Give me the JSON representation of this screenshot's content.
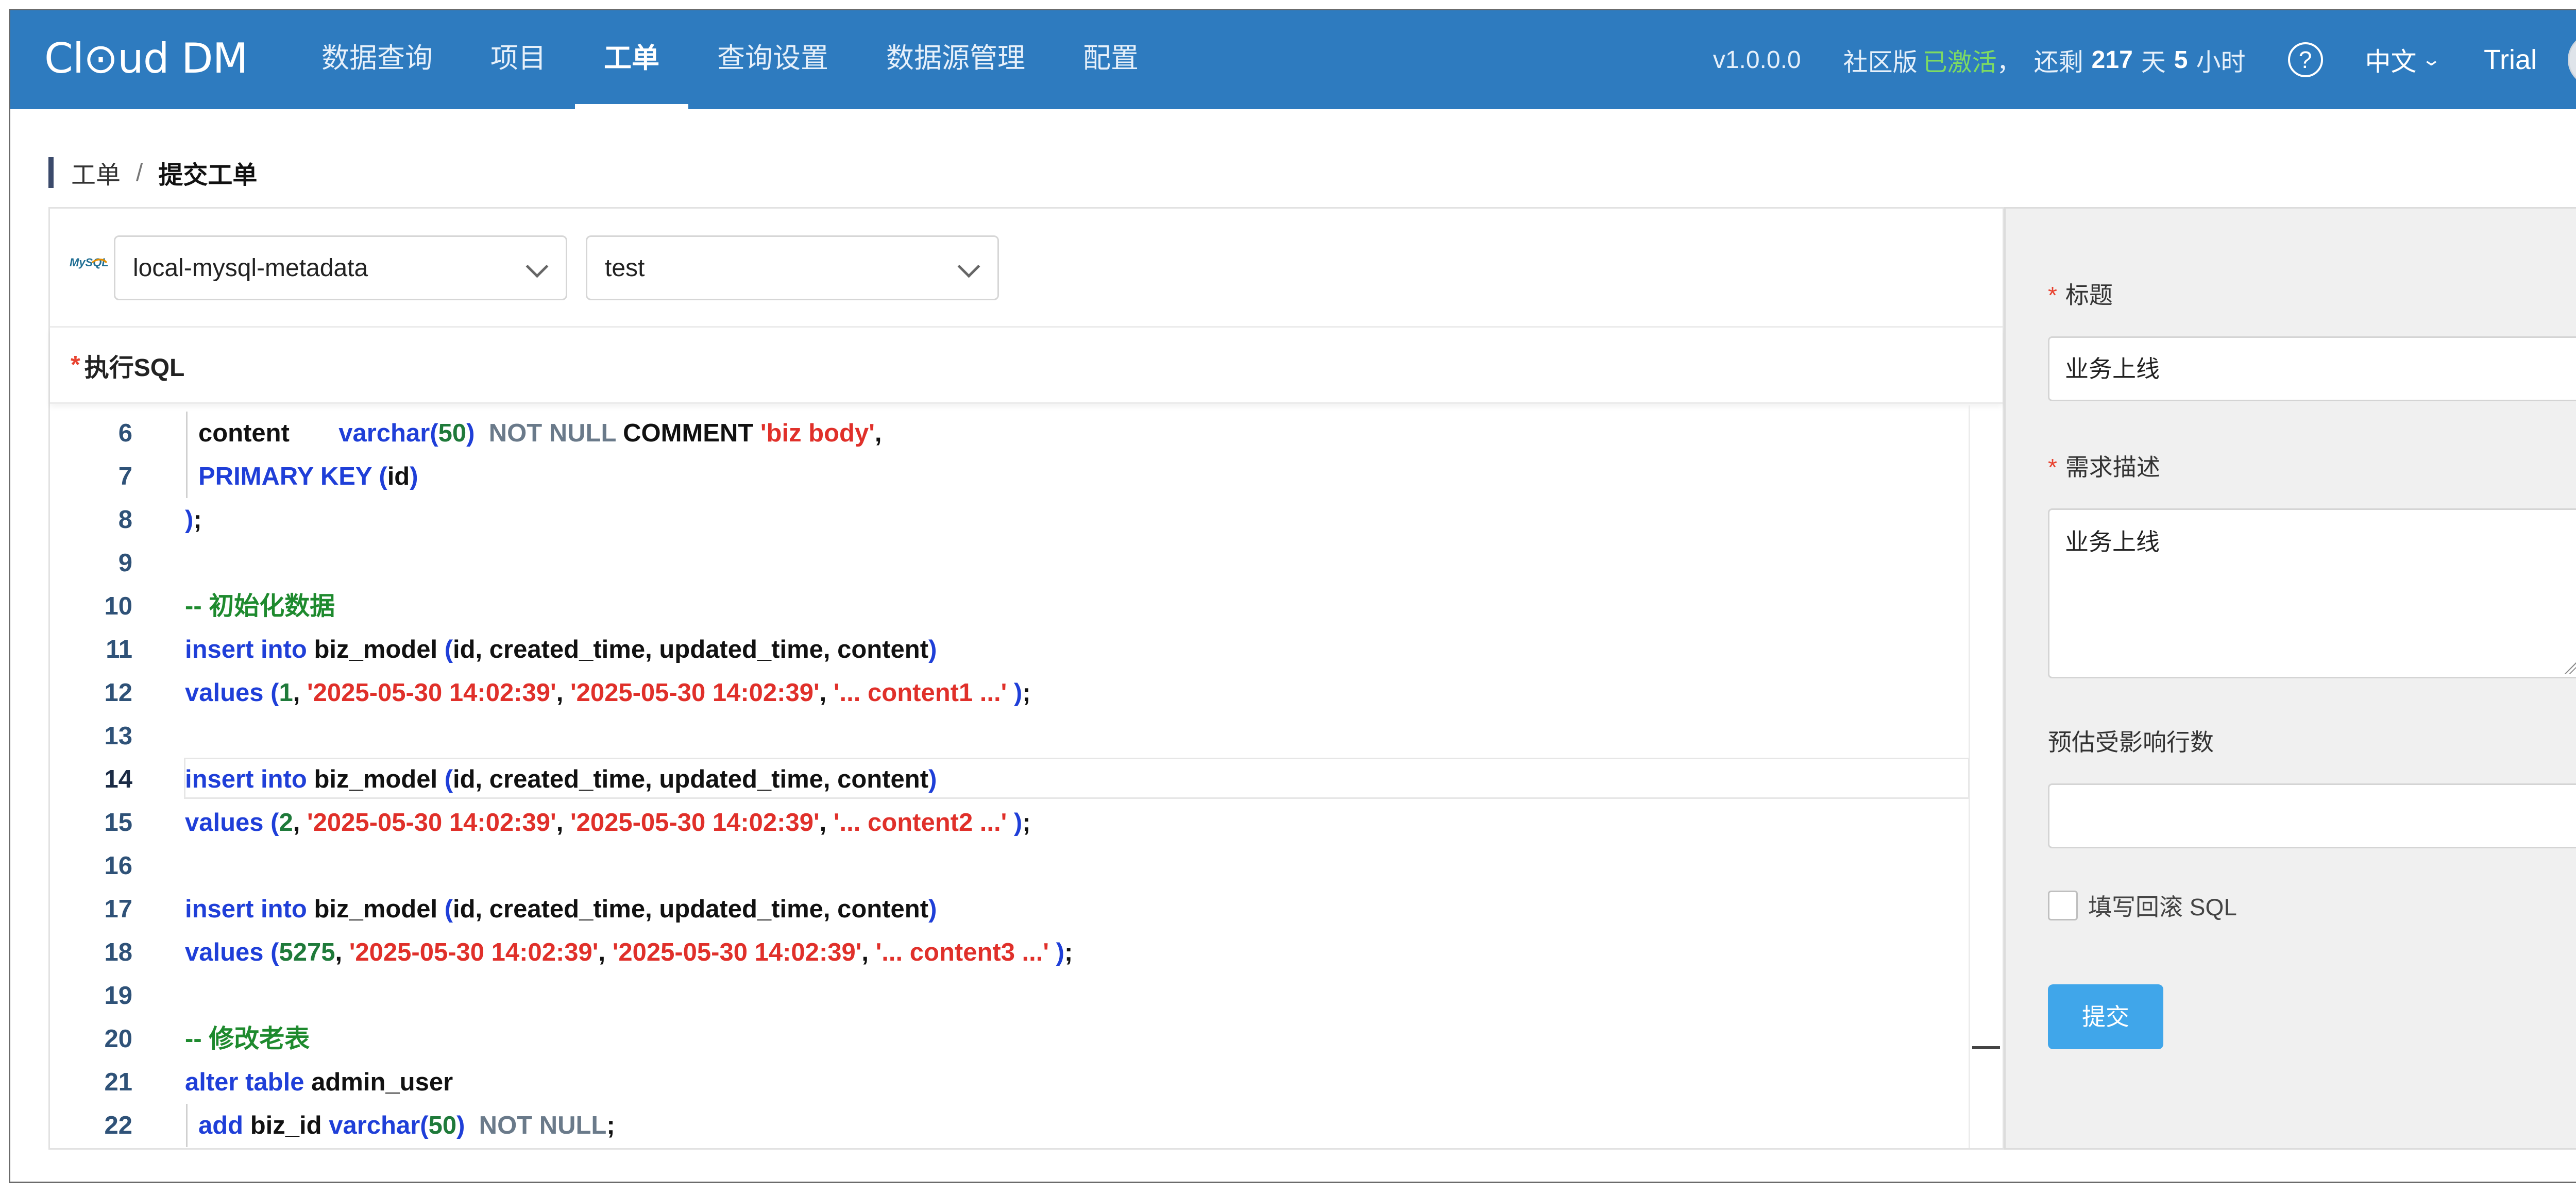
{
  "header": {
    "logo": "Cl⊙ud DM",
    "nav": [
      "数据查询",
      "项目",
      "工单",
      "查询设置",
      "数据源管理",
      "配置"
    ],
    "active_nav": "工单",
    "version": "v1.0.0.0",
    "license_edition": "社区版",
    "license_status": "已激活",
    "license_sep": "，",
    "license_remaining_prefix": "还剩",
    "license_days": "217",
    "license_days_unit": "天",
    "license_hours": "5",
    "license_hours_unit": "小时",
    "help_icon": "?",
    "language": "中文",
    "plan": "Trial"
  },
  "breadcrumb": {
    "parent": "工单",
    "separator": "/",
    "current": "提交工单"
  },
  "editor_panel": {
    "datasource_logo": "MySQL",
    "datasource": "local-mysql-metadata",
    "database": "test",
    "sql_label_required": "*",
    "sql_label": "执行SQL",
    "lines": [
      {
        "n": "6",
        "tokens": [
          {
            "t": "content",
            "c": ""
          },
          {
            "t": "       ",
            "c": ""
          },
          {
            "t": "varchar",
            "c": "kw"
          },
          {
            "t": "(",
            "c": "pl"
          },
          {
            "t": "50",
            "c": "num-lit"
          },
          {
            "t": ")",
            "c": "pl"
          },
          {
            "t": "  NOT NULL ",
            "c": "gray"
          },
          {
            "t": "COMMENT ",
            "c": ""
          },
          {
            "t": "'biz body'",
            "c": "str"
          },
          {
            "t": ",",
            "c": ""
          }
        ],
        "indent": true
      },
      {
        "n": "7",
        "tokens": [
          {
            "t": "PRIMARY KEY ",
            "c": "kw"
          },
          {
            "t": "(",
            "c": "pl"
          },
          {
            "t": "id",
            "c": ""
          },
          {
            "t": ")",
            "c": "pl"
          }
        ],
        "indent": true
      },
      {
        "n": "8",
        "tokens": [
          {
            "t": ")",
            "c": "pl"
          },
          {
            "t": ";",
            "c": ""
          }
        ]
      },
      {
        "n": "9",
        "tokens": []
      },
      {
        "n": "10",
        "tokens": [
          {
            "t": "-- 初始化数据",
            "c": "cm"
          }
        ]
      },
      {
        "n": "11",
        "tokens": [
          {
            "t": "insert into ",
            "c": "kw"
          },
          {
            "t": "biz_model ",
            "c": ""
          },
          {
            "t": "(",
            "c": "pl"
          },
          {
            "t": "id, created_time, updated_time, content",
            "c": ""
          },
          {
            "t": ")",
            "c": "pl"
          }
        ]
      },
      {
        "n": "12",
        "tokens": [
          {
            "t": "values ",
            "c": "kw"
          },
          {
            "t": "(",
            "c": "pl"
          },
          {
            "t": "1",
            "c": "num-lit"
          },
          {
            "t": ", ",
            "c": ""
          },
          {
            "t": "'2025-05-30 14:02:39'",
            "c": "str"
          },
          {
            "t": ", ",
            "c": ""
          },
          {
            "t": "'2025-05-30 14:02:39'",
            "c": "str"
          },
          {
            "t": ", ",
            "c": ""
          },
          {
            "t": "'... content1 ...'",
            "c": "str"
          },
          {
            "t": " )",
            "c": "pl"
          },
          {
            "t": ";",
            "c": ""
          }
        ]
      },
      {
        "n": "13",
        "tokens": []
      },
      {
        "n": "14",
        "tokens": [
          {
            "t": "insert into ",
            "c": "kw"
          },
          {
            "t": "biz_model ",
            "c": ""
          },
          {
            "t": "(",
            "c": "pl"
          },
          {
            "t": "id, created_time, updated_time, content",
            "c": ""
          },
          {
            "t": ")",
            "c": "pl"
          }
        ],
        "active": true
      },
      {
        "n": "15",
        "tokens": [
          {
            "t": "values ",
            "c": "kw"
          },
          {
            "t": "(",
            "c": "pl"
          },
          {
            "t": "2",
            "c": "num-lit"
          },
          {
            "t": ", ",
            "c": ""
          },
          {
            "t": "'2025-05-30 14:02:39'",
            "c": "str"
          },
          {
            "t": ", ",
            "c": ""
          },
          {
            "t": "'2025-05-30 14:02:39'",
            "c": "str"
          },
          {
            "t": ", ",
            "c": ""
          },
          {
            "t": "'... content2 ...'",
            "c": "str"
          },
          {
            "t": " )",
            "c": "pl"
          },
          {
            "t": ";",
            "c": ""
          }
        ]
      },
      {
        "n": "16",
        "tokens": []
      },
      {
        "n": "17",
        "tokens": [
          {
            "t": "insert into ",
            "c": "kw"
          },
          {
            "t": "biz_model ",
            "c": ""
          },
          {
            "t": "(",
            "c": "pl"
          },
          {
            "t": "id, created_time, updated_time, content",
            "c": ""
          },
          {
            "t": ")",
            "c": "pl"
          }
        ]
      },
      {
        "n": "18",
        "tokens": [
          {
            "t": "values ",
            "c": "kw"
          },
          {
            "t": "(",
            "c": "pl"
          },
          {
            "t": "5275",
            "c": "num-lit"
          },
          {
            "t": ", ",
            "c": ""
          },
          {
            "t": "'2025-05-30 14:02:39'",
            "c": "str"
          },
          {
            "t": ", ",
            "c": ""
          },
          {
            "t": "'2025-05-30 14:02:39'",
            "c": "str"
          },
          {
            "t": ", ",
            "c": ""
          },
          {
            "t": "'... content3 ...'",
            "c": "str"
          },
          {
            "t": " )",
            "c": "pl"
          },
          {
            "t": ";",
            "c": ""
          }
        ]
      },
      {
        "n": "19",
        "tokens": []
      },
      {
        "n": "20",
        "tokens": [
          {
            "t": "-- 修改老表",
            "c": "cm"
          }
        ]
      },
      {
        "n": "21",
        "tokens": [
          {
            "t": "alter table ",
            "c": "kw"
          },
          {
            "t": "admin_user",
            "c": ""
          }
        ]
      },
      {
        "n": "22",
        "tokens": [
          {
            "t": "add ",
            "c": "kw"
          },
          {
            "t": "biz_id ",
            "c": ""
          },
          {
            "t": "varchar",
            "c": "kw"
          },
          {
            "t": "(",
            "c": "pl"
          },
          {
            "t": "50",
            "c": "num-lit"
          },
          {
            "t": ")",
            "c": "pl"
          },
          {
            "t": "  NOT NULL",
            "c": "gray"
          },
          {
            "t": ";",
            "c": ""
          }
        ],
        "indent": true
      }
    ]
  },
  "form": {
    "required_mark": "*",
    "title_label": "标题",
    "title_value": "业务上线",
    "desc_label": "需求描述",
    "desc_value": "业务上线",
    "rows_label": "预估受影响行数",
    "rows_value": "",
    "rollback_label": "填写回滚 SQL",
    "rollback_checked": false,
    "submit_label": "提交"
  },
  "colors": {
    "topbar": "#2e7bbf",
    "activated": "#7ddb62",
    "submit": "#40a6ea",
    "keyword": "#1f3fd8",
    "string": "#e0302a",
    "comment": "#1e8a2e"
  }
}
